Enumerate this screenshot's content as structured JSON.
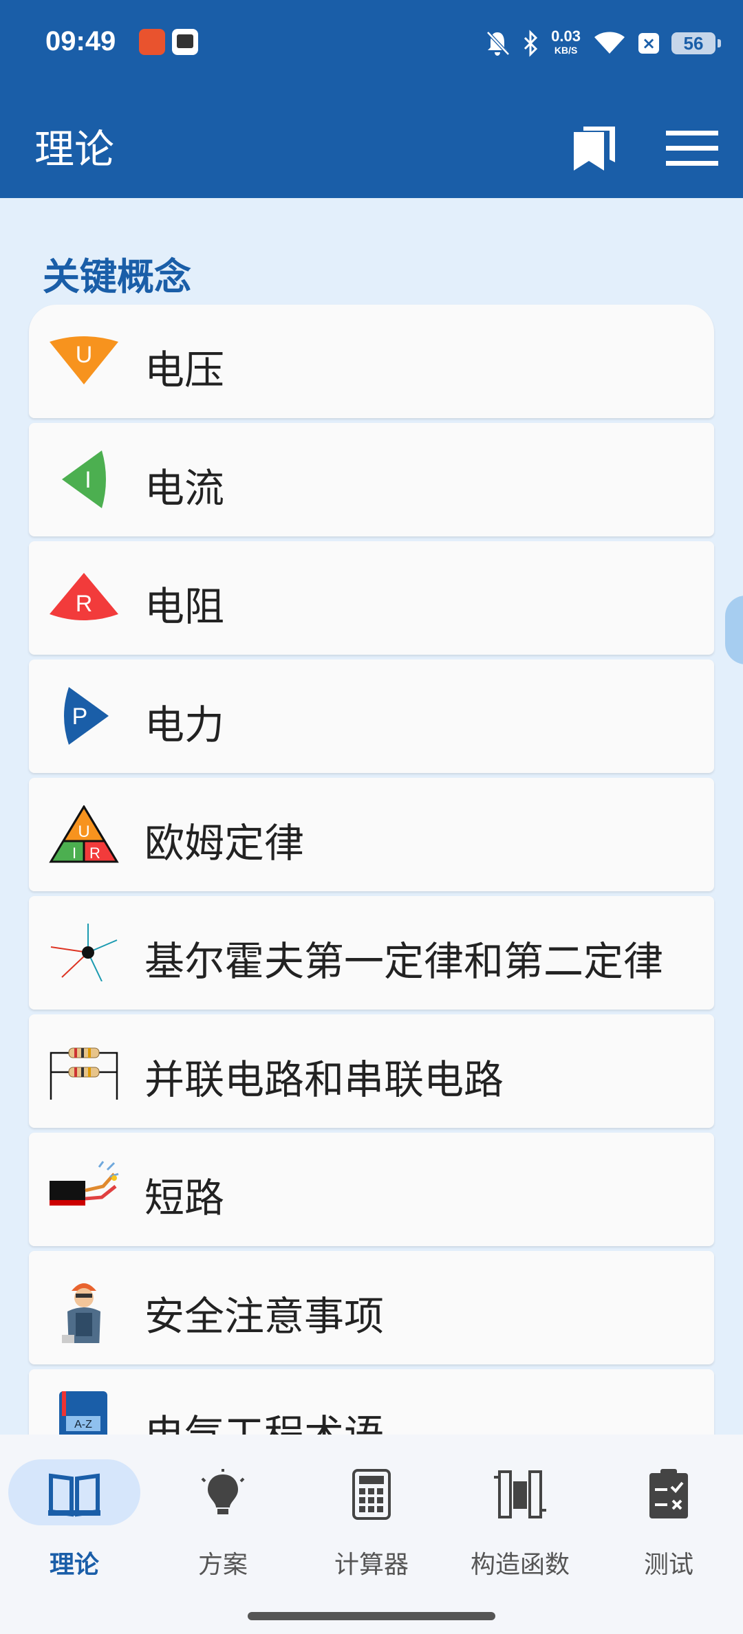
{
  "status_bar": {
    "time": "09:49",
    "net_speed": "0.03",
    "net_unit": "KB/S",
    "battery": "56",
    "icons": [
      "notification-app-icon",
      "mt-app-icon",
      "bell-muted-icon",
      "bluetooth-icon",
      "wifi-icon",
      "x-app-icon",
      "battery-icon"
    ]
  },
  "app_bar": {
    "title": "理论",
    "actions": [
      "bookmark-icon",
      "menu-icon"
    ]
  },
  "section": {
    "title": "关键概念"
  },
  "items": [
    {
      "label": "电压",
      "icon": "voltage-icon",
      "color": "#f7931e"
    },
    {
      "label": "电流",
      "icon": "current-icon",
      "color": "#4caf50"
    },
    {
      "label": "电阻",
      "icon": "resistance-icon",
      "color": "#f23b3b"
    },
    {
      "label": "电力",
      "icon": "power-icon",
      "color": "#1a5ea8"
    },
    {
      "label": "欧姆定律",
      "icon": "ohms-law-triangle-icon"
    },
    {
      "label": "基尔霍夫第一定律和第二定律",
      "icon": "kirchhoff-node-icon"
    },
    {
      "label": "并联电路和串联电路",
      "icon": "circuit-resistors-icon"
    },
    {
      "label": "短路",
      "icon": "short-circuit-icon"
    },
    {
      "label": "安全注意事项",
      "icon": "electrician-icon"
    },
    {
      "label": "电气工程术语",
      "icon": "dictionary-az-icon"
    }
  ],
  "bottom_nav": [
    {
      "label": "理论",
      "icon": "book-icon",
      "active": true
    },
    {
      "label": "方案",
      "icon": "lightbulb-icon",
      "active": false
    },
    {
      "label": "计算器",
      "icon": "calculator-icon",
      "active": false
    },
    {
      "label": "构造函数",
      "icon": "circuit-board-icon",
      "active": false
    },
    {
      "label": "测试",
      "icon": "test-clipboard-icon",
      "active": false
    }
  ],
  "colors": {
    "primary": "#1a5ea8",
    "background": "#e3effb",
    "card": "#fafafa"
  }
}
